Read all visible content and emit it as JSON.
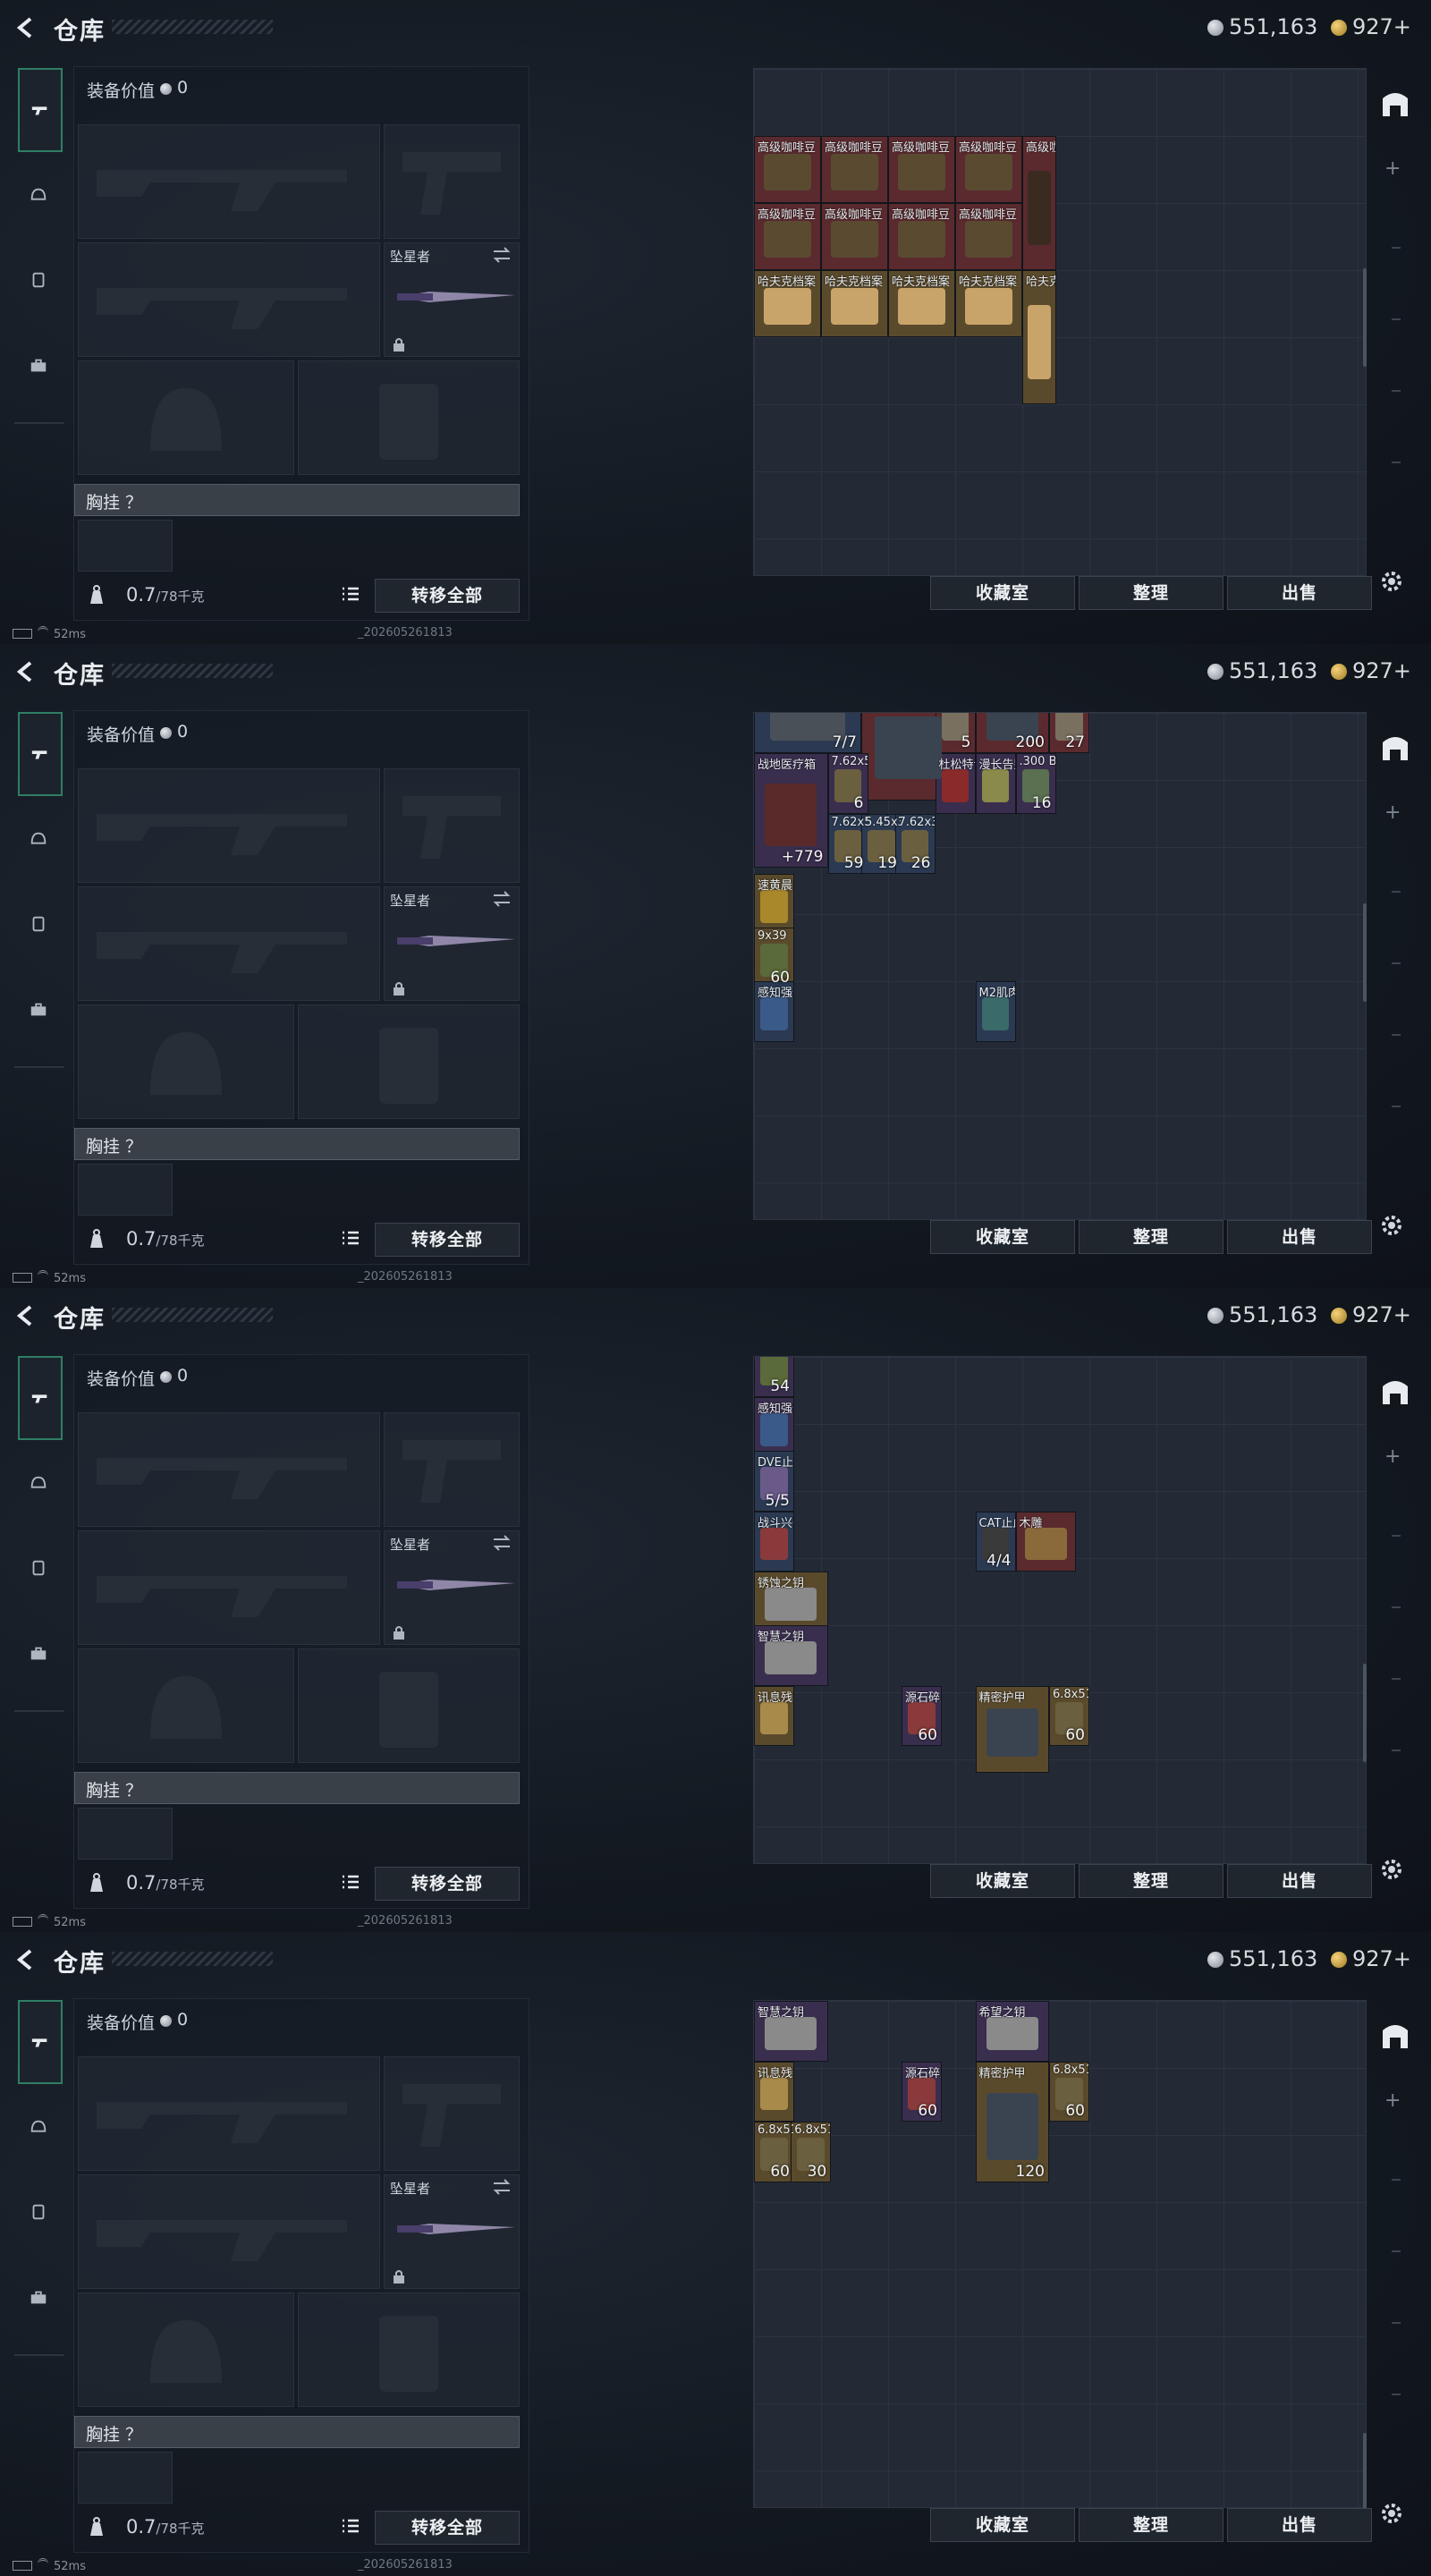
{
  "header": {
    "title": "仓库",
    "silver": "551,163",
    "gold": "927+"
  },
  "loadout": {
    "equip_label": "装备价值",
    "equip_value": "0",
    "melee_label": "坠星者",
    "chest_label": "胸挂 ？",
    "weight_value": "0.7",
    "weight_max": "/78千克",
    "transfer_all": "转移全部"
  },
  "stash_buttons": {
    "vault": "收藏室",
    "sort": "整理",
    "sell": "出售"
  },
  "status": {
    "ping": "52ms",
    "build": "_202605261813"
  },
  "icons": [
    "back-icon",
    "gun-icon",
    "helmet-icon",
    "vest-icon",
    "case-icon",
    "lock-icon",
    "swap-icon",
    "list-icon",
    "silver-coin-icon",
    "gold-coin-icon",
    "vault-icon",
    "gear-icon",
    "armor-icon",
    "blueprint-icon"
  ],
  "colors": {
    "accent_green": "#2e7f66",
    "rare_red": "#5a2a2e",
    "rare_gold": "#5a4a2c",
    "rare_blue": "#2b3a52",
    "rare_purple": "#3a2e4e"
  },
  "frames": [
    {
      "scrollbar_fraction": 0.2,
      "items": [
        {
          "n": "",
          "c": "",
          "x": 0,
          "y": -10,
          "w": 1,
          "h": 1,
          "r": "red",
          "a": "#6a5a3e"
        },
        {
          "n": "高级咖啡豆",
          "c": "",
          "x": 0,
          "y": 10,
          "w": 1,
          "h": 1,
          "r": "red",
          "a": "#5a4a30"
        },
        {
          "n": "高级咖啡豆",
          "c": "",
          "x": 1,
          "y": 10,
          "w": 1,
          "h": 1,
          "r": "red",
          "a": "#5a4a30"
        },
        {
          "n": "高级咖啡豆",
          "c": "",
          "x": 2,
          "y": 10,
          "w": 1,
          "h": 1,
          "r": "red",
          "a": "#5a4a30"
        },
        {
          "n": "",
          "c": "",
          "x": 3,
          "y": -10,
          "w": 1,
          "h": 1.8,
          "r": "red",
          "a": "#9a9aa0"
        },
        {
          "n": "",
          "c": "",
          "x": 4,
          "y": -10,
          "w": 0.5,
          "h": 1.8,
          "r": "red",
          "a": "#3a2a20"
        },
        {
          "n": "高级咖啡豆",
          "c": "",
          "x": 0,
          "y": 1,
          "w": 1,
          "h": 1,
          "r": "red",
          "a": "#5a4a30"
        },
        {
          "n": "高级咖啡豆",
          "c": "",
          "x": 1,
          "y": 1,
          "w": 1,
          "h": 1,
          "r": "red",
          "a": "#5a4a30"
        },
        {
          "n": "高级咖啡豆",
          "c": "",
          "x": 2,
          "y": 1,
          "w": 1,
          "h": 1,
          "r": "red",
          "a": "#5a4a30"
        },
        {
          "n": "高级咖啡豆",
          "c": "",
          "x": 3,
          "y": 1,
          "w": 1,
          "h": 1,
          "r": "red",
          "a": "#5a4a30"
        },
        {
          "n": "高级咖啡豆",
          "c": "",
          "x": 4,
          "y": 1,
          "w": 0.5,
          "h": 2,
          "r": "red",
          "a": "#3a2a20"
        },
        {
          "n": "高级咖啡豆",
          "c": "",
          "x": 0,
          "y": 2,
          "w": 1,
          "h": 1,
          "r": "red",
          "a": "#5a4a30"
        },
        {
          "n": "高级咖啡豆",
          "c": "",
          "x": 1,
          "y": 2,
          "w": 1,
          "h": 1,
          "r": "red",
          "a": "#5a4a30"
        },
        {
          "n": "高级咖啡豆",
          "c": "",
          "x": 2,
          "y": 2,
          "w": 1,
          "h": 1,
          "r": "red",
          "a": "#5a4a30"
        },
        {
          "n": "高级咖啡豆",
          "c": "",
          "x": 3,
          "y": 2,
          "w": 1,
          "h": 1,
          "r": "red",
          "a": "#5a4a30"
        },
        {
          "n": "哈夫克档案",
          "c": "",
          "x": 0,
          "y": 3,
          "w": 1,
          "h": 1,
          "r": "gold",
          "a": "#c9a46a"
        },
        {
          "n": "哈夫克档案",
          "c": "",
          "x": 1,
          "y": 3,
          "w": 1,
          "h": 1,
          "r": "gold",
          "a": "#c9a46a"
        },
        {
          "n": "哈夫克档案",
          "c": "",
          "x": 2,
          "y": 3,
          "w": 1,
          "h": 1,
          "r": "gold",
          "a": "#c9a46a"
        },
        {
          "n": "哈夫克档案",
          "c": "",
          "x": 3,
          "y": 3,
          "w": 1,
          "h": 1,
          "r": "gold",
          "a": "#c9a46a"
        },
        {
          "n": "哈夫克档案",
          "c": "",
          "x": 4,
          "y": 3,
          "w": 0.5,
          "h": 2,
          "r": "gold",
          "a": "#c9a46a"
        }
      ]
    }
  ]
}
